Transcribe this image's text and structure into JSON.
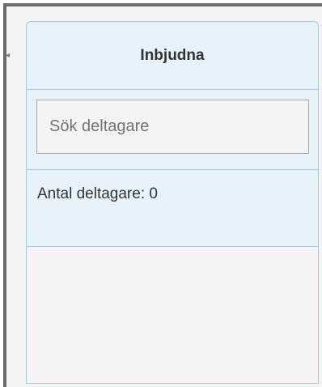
{
  "panel": {
    "title": "Inbjudna"
  },
  "search": {
    "placeholder": "Sök deltagare",
    "value": ""
  },
  "participants": {
    "count_label": "Antal deltagare: 0",
    "items": []
  }
}
